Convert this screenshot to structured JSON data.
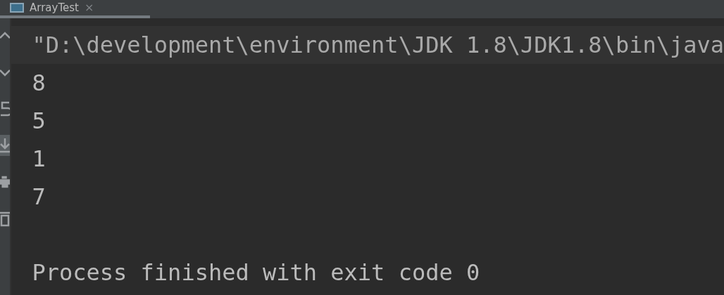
{
  "tab": {
    "title": "ArrayTest",
    "close": "×",
    "selected": true
  },
  "toolbar": [
    {
      "kind": "up",
      "selected": false
    },
    {
      "kind": "down",
      "selected": false
    },
    {
      "kind": "wrap",
      "selected": false
    },
    {
      "kind": "scroll",
      "selected": true
    },
    {
      "kind": "print",
      "selected": false
    },
    {
      "kind": "trash",
      "selected": false
    }
  ],
  "console": {
    "command": "\"D:\\development\\environment\\JDK 1.8\\JDK1.8\\bin\\java",
    "output": [
      "8",
      "5",
      "1",
      "7"
    ],
    "exit_message": "Process finished with exit code 0"
  }
}
